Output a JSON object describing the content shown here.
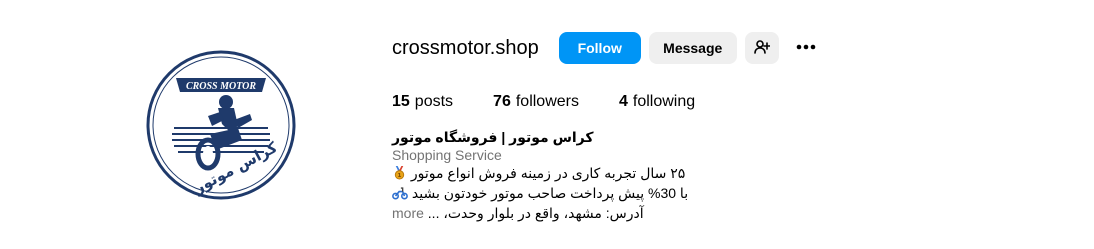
{
  "profile": {
    "username": "crossmotor.shop",
    "avatar_logo_top": "CROSS MOTOR",
    "avatar_logo_bottom": "کراس موتور"
  },
  "actions": {
    "follow_label": "Follow",
    "message_label": "Message",
    "suggest_icon": "add-person-icon",
    "more_icon": "more-options-icon"
  },
  "stats": {
    "posts_count": "15",
    "posts_label": "posts",
    "followers_count": "76",
    "followers_label": "followers",
    "following_count": "4",
    "following_label": "following"
  },
  "bio": {
    "full_name": "کراس موتور | فروشگاه موتور",
    "category": "Shopping Service",
    "line1": "۲۵ سال تجربه کاری در زمینه فروش انواع موتور",
    "line1_emoji": "medal-icon",
    "line2": "با 30% پیش پرداخت صاحب موتور خودتون بشید",
    "line2_emoji": "motor-scooter-icon",
    "line3": "آدرس: مشهد، واقع در بلوار وحدت، ...",
    "more_label": "more"
  },
  "colors": {
    "follow_blue": "#0095f6",
    "secondary_button": "#efefef",
    "muted_text": "#737373",
    "logo_navy": "#1f3a6b"
  }
}
